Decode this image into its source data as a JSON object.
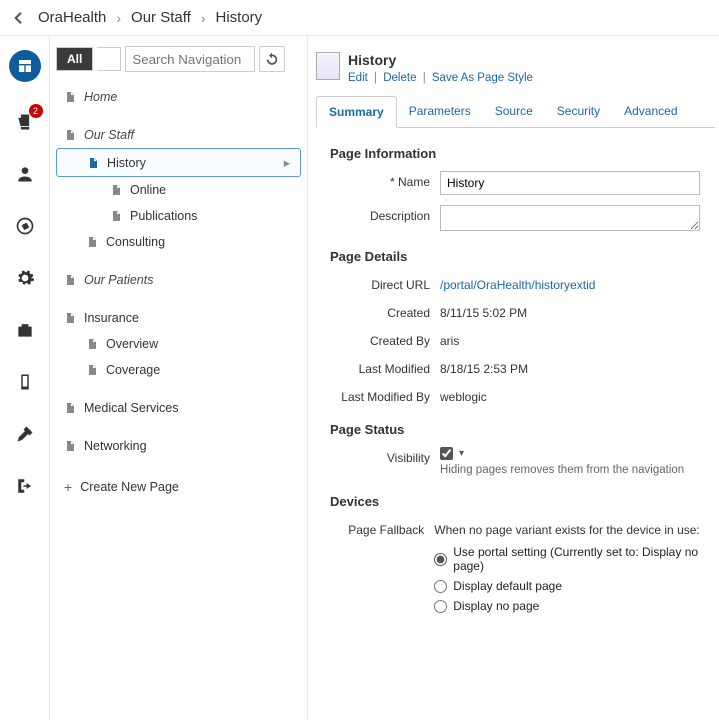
{
  "breadcrumb": [
    "OraHealth",
    "Our Staff",
    "History"
  ],
  "rail": {
    "badge_count": "2"
  },
  "nav": {
    "all_label": "All",
    "search_placeholder": "Search Navigation",
    "items": [
      {
        "label": "Home",
        "level": 1,
        "section": true
      },
      {
        "label": "Our Staff",
        "level": 1,
        "section": true
      },
      {
        "label": "History",
        "level": 2,
        "selected": true,
        "hasArrow": true
      },
      {
        "label": "Online",
        "level": 3
      },
      {
        "label": "Publications",
        "level": 3
      },
      {
        "label": "Consulting",
        "level": 2
      },
      {
        "label": "Our Patients",
        "level": 1,
        "section": true
      },
      {
        "label": "Insurance",
        "level": 1
      },
      {
        "label": "Overview",
        "level": 2
      },
      {
        "label": "Coverage",
        "level": 2
      },
      {
        "label": "Medical Services",
        "level": 1
      },
      {
        "label": "Networking",
        "level": 1
      }
    ],
    "create_label": "Create New Page"
  },
  "page": {
    "title": "History",
    "actions": {
      "edit": "Edit",
      "delete": "Delete",
      "save_as": "Save As Page Style"
    },
    "tabs": [
      "Summary",
      "Parameters",
      "Source",
      "Security",
      "Advanced"
    ],
    "active_tab": 0,
    "sections": {
      "info_h": "Page Information",
      "name_label": "Name",
      "name_value": "History",
      "desc_label": "Description",
      "desc_value": "",
      "details_h": "Page Details",
      "url_label": "Direct URL",
      "url_value": "/portal/OraHealth/historyextid",
      "created_label": "Created",
      "created_value": "8/11/15 5:02 PM",
      "createdby_label": "Created By",
      "createdby_value": "aris",
      "modified_label": "Last Modified",
      "modified_value": "8/18/15 2:53 PM",
      "modifiedby_label": "Last Modified By",
      "modifiedby_value": "weblogic",
      "status_h": "Page Status",
      "vis_label": "Visibility",
      "vis_checked": true,
      "vis_hint": "Hiding pages removes them from the navigation",
      "devices_h": "Devices",
      "fallback_label": "Page Fallback",
      "fallback_intro": "When no page variant exists for the device in use:",
      "fallback_opts": [
        "Use portal setting (Currently set to: Display no page)",
        "Display default page",
        "Display no page"
      ],
      "fallback_selected": 0
    }
  }
}
